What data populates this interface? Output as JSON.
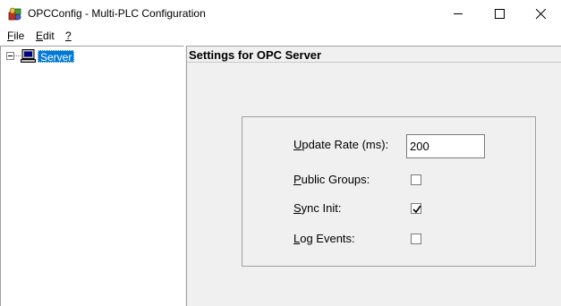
{
  "window": {
    "title": "OPCConfig - Multi-PLC Configuration"
  },
  "menu": {
    "file": {
      "label_ul": "F",
      "label_rest": "ile"
    },
    "edit": {
      "label_ul": "E",
      "label_rest": "dit"
    },
    "help": {
      "label_ul": "?",
      "label_rest": ""
    }
  },
  "tree": {
    "root": {
      "label": "Server",
      "expanded": true,
      "selected": true,
      "icon": "computer-icon"
    }
  },
  "settings": {
    "title": "Settings for OPC Server",
    "update_rate": {
      "label_ul": "U",
      "label_rest": "pdate Rate (ms):",
      "value": "200"
    },
    "public_groups": {
      "label_ul": "P",
      "label_rest": "ublic Groups:",
      "checked": false
    },
    "sync_init": {
      "label_ul": "S",
      "label_rest": "ync Init:",
      "checked": true
    },
    "log_events": {
      "label_ul": "L",
      "label_rest": "og Events:",
      "checked": false
    }
  },
  "colors": {
    "selection": "#0078d7",
    "panel": "#f0f0f0"
  }
}
